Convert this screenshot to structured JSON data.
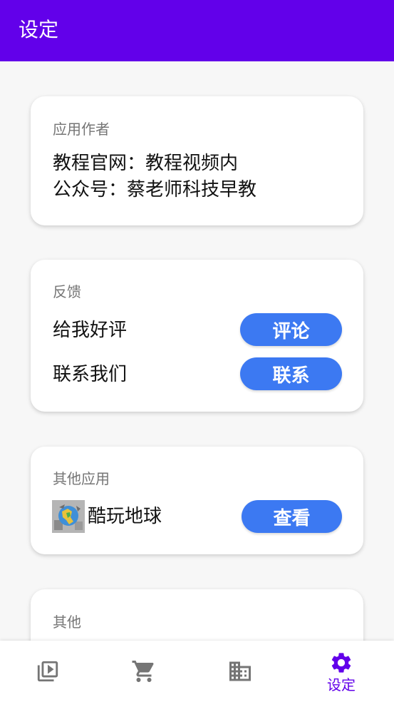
{
  "app_bar": {
    "title": "设定"
  },
  "cards": {
    "author": {
      "heading": "应用作者",
      "line1": "教程官网：教程视频内",
      "line2": "公众号：蔡老师科技早教"
    },
    "feedback": {
      "heading": "反馈",
      "rate_label": "给我好评",
      "rate_button": "评论",
      "contact_label": "联系我们",
      "contact_button": "联系"
    },
    "other_apps": {
      "heading": "其他应用",
      "app_name": "酷玩地球",
      "view_button": "查看"
    },
    "other": {
      "heading": "其他"
    }
  },
  "bottom_nav": {
    "items": [
      {
        "icon": "video-library-icon",
        "label": "",
        "active": false
      },
      {
        "icon": "shopping-cart-icon",
        "label": "",
        "active": false
      },
      {
        "icon": "building-icon",
        "label": "",
        "active": false
      },
      {
        "icon": "gear-icon",
        "label": "设定",
        "active": true
      }
    ]
  },
  "colors": {
    "primary": "#6200ea",
    "button": "#3c79f2",
    "inactive_icon": "#757575",
    "background": "#f7f7f7"
  }
}
